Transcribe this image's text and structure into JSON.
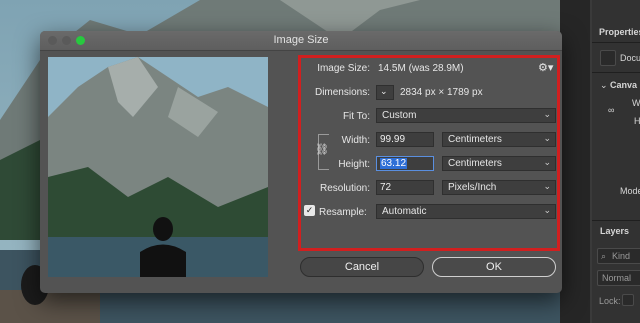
{
  "dialog": {
    "title": "Image Size",
    "image_size_label": "Image Size:",
    "image_size_value": "14.5M (was 28.9M)",
    "dimensions_label": "Dimensions:",
    "dimensions_value": "2834 px  ×  1789 px",
    "fit_to_label": "Fit To:",
    "fit_to_value": "Custom",
    "width_label": "Width:",
    "width_value": "99.99",
    "width_unit": "Centimeters",
    "height_label": "Height:",
    "height_value": "63.12",
    "height_unit": "Centimeters",
    "resolution_label": "Resolution:",
    "resolution_value": "72",
    "resolution_unit": "Pixels/Inch",
    "resample_label": "Resample:",
    "resample_checked": true,
    "resample_value": "Automatic",
    "cancel_label": "Cancel",
    "ok_label": "OK"
  },
  "panels": {
    "properties": "Properties",
    "doc": "Docu",
    "canvas": "Canva",
    "w": "W",
    "h": "H",
    "mode": "Mode",
    "layers": "Layers",
    "kind": "Kind",
    "normal": "Normal",
    "lock": "Lock:"
  },
  "colors": {
    "accent_red": "#d11f1f",
    "selection_blue": "#2f6fd6"
  }
}
